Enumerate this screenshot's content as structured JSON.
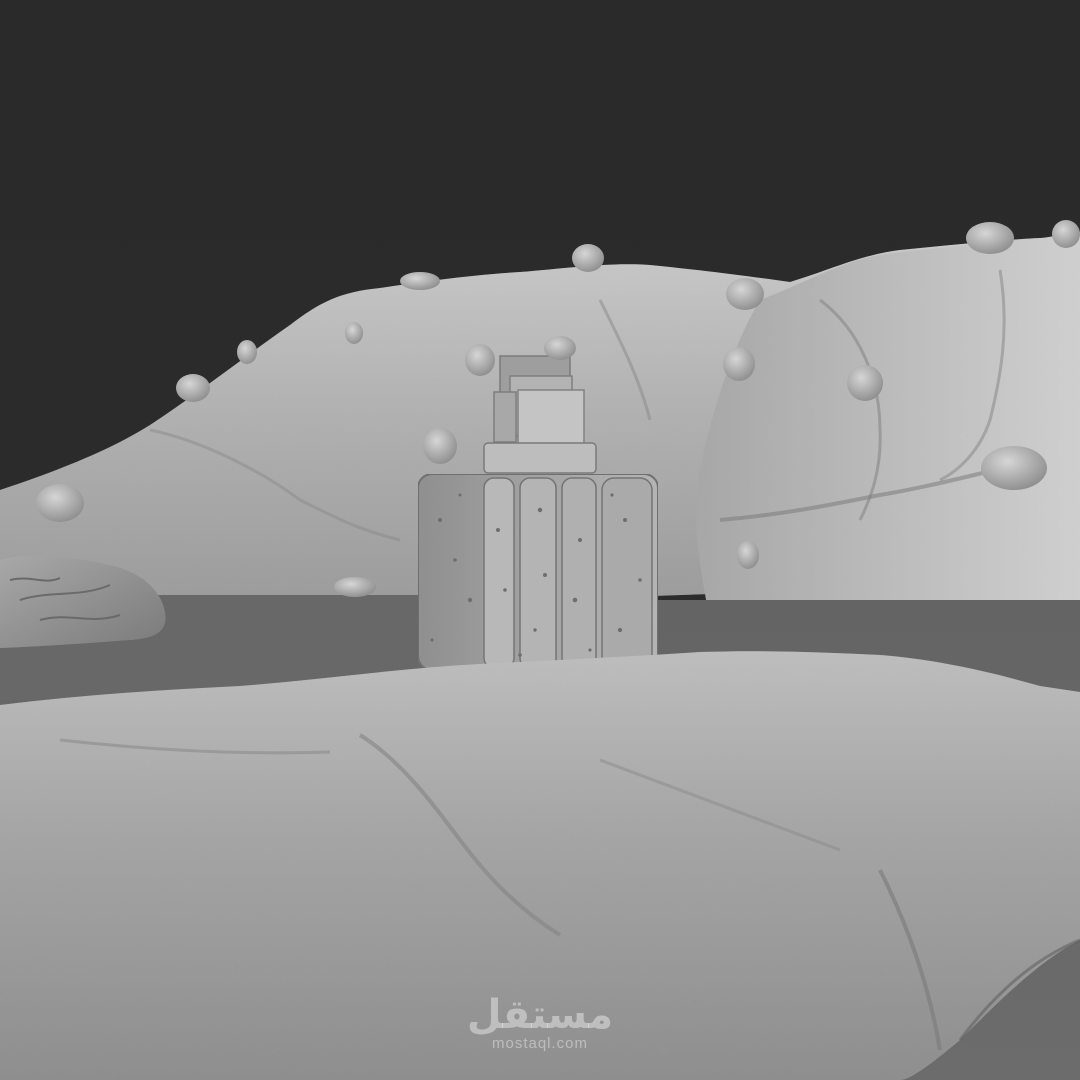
{
  "scene": {
    "background_color": "#2b2b2b",
    "ground_color": "#696969",
    "terrain_color": "#9a9a9a",
    "terrain_highlight": "#bdbdbd",
    "terrain_shadow": "#6e6e6e"
  },
  "watermark": {
    "arabic_text": "مستقل",
    "latin_text": "mostaql.com"
  }
}
